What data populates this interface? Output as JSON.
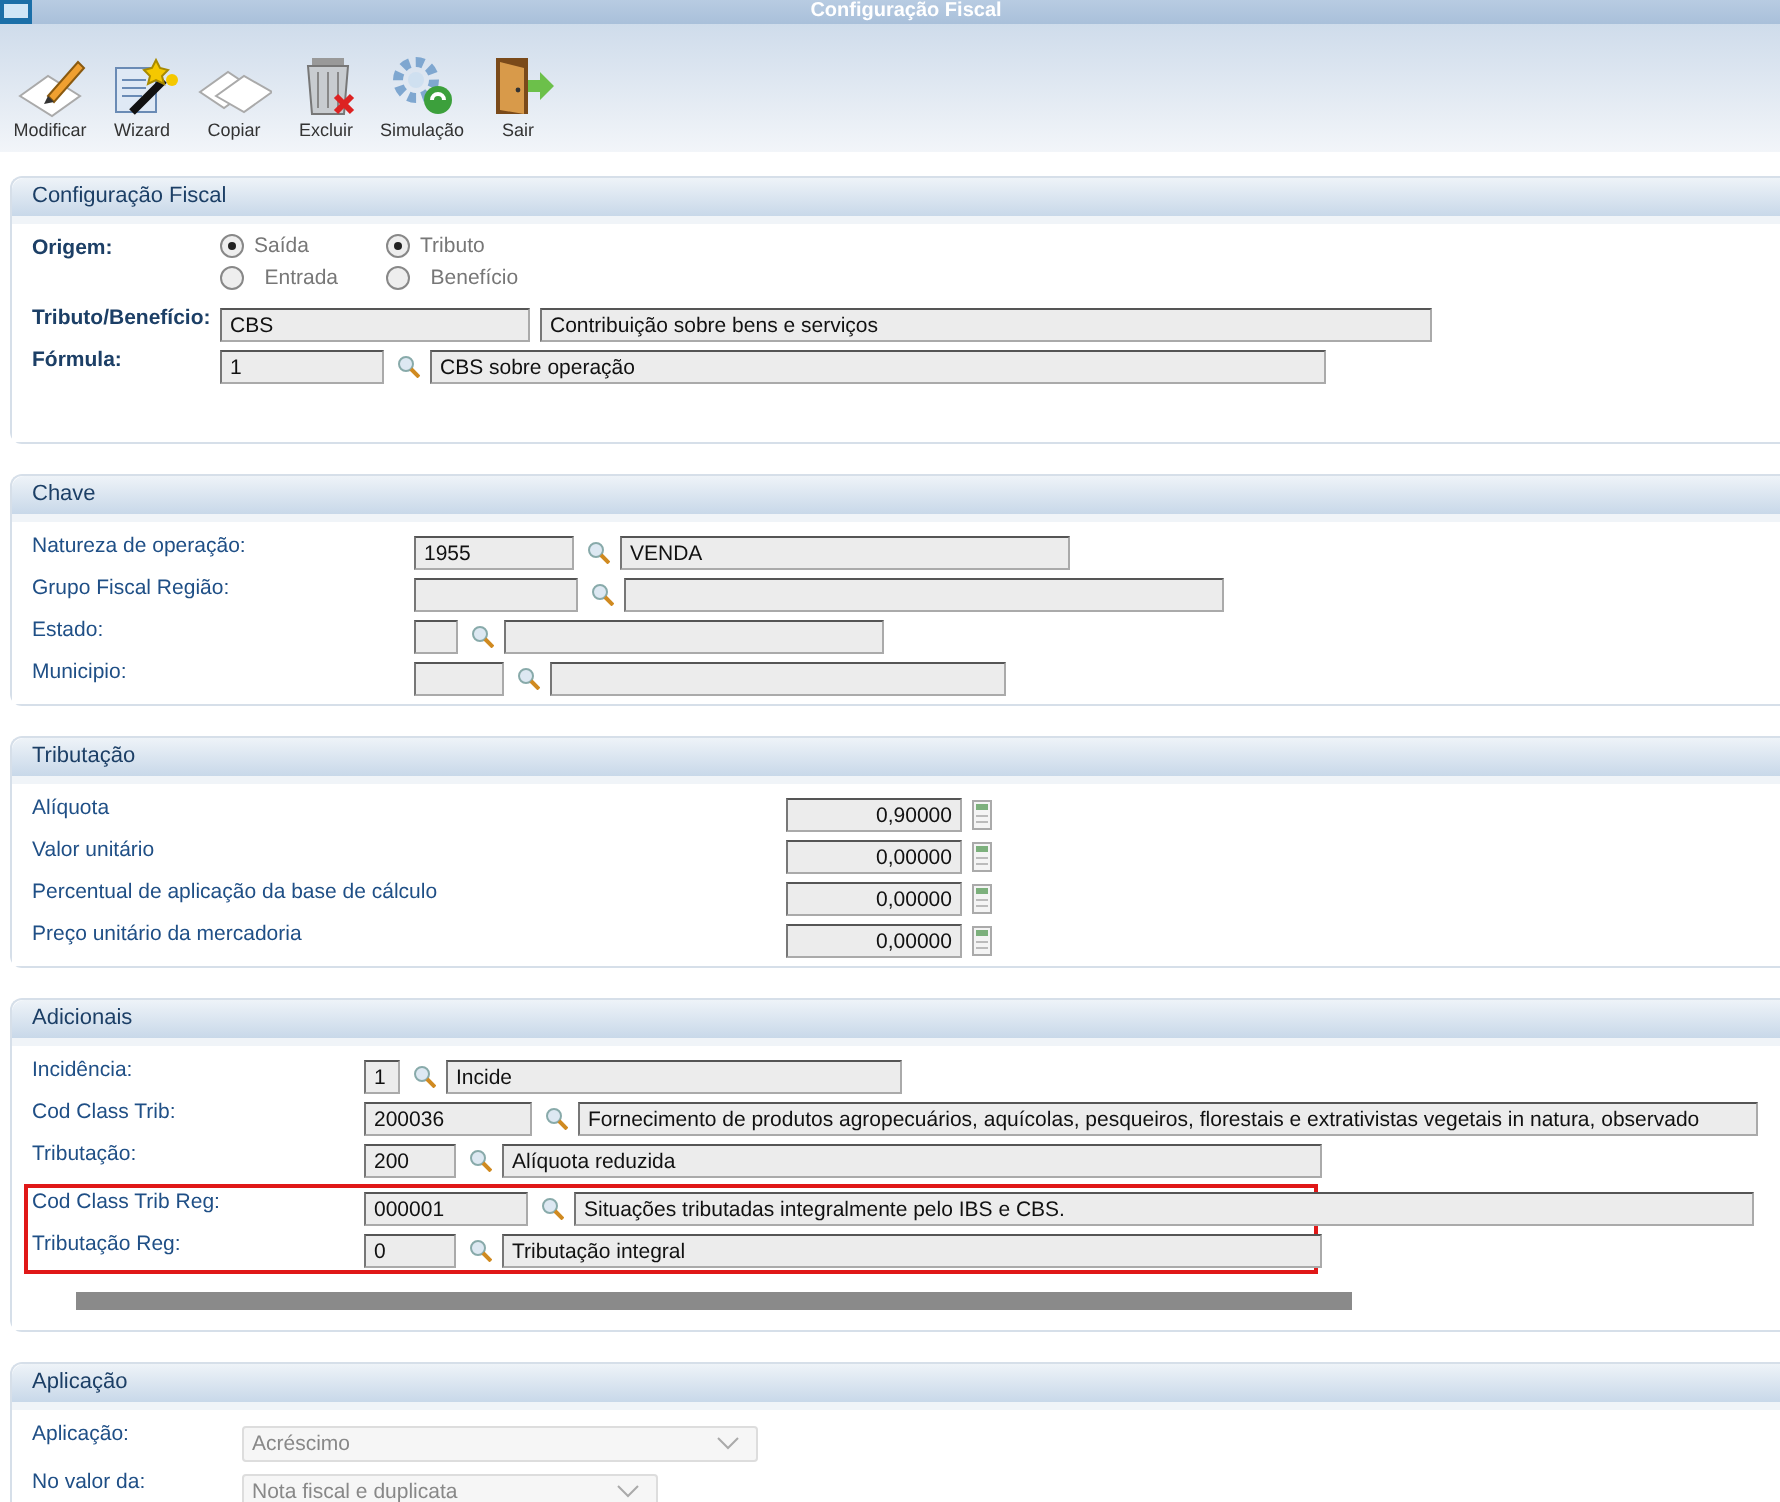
{
  "window": {
    "title": "Configuração Fiscal"
  },
  "toolbar": [
    {
      "label": "Modificar",
      "kind": "pencil"
    },
    {
      "label": "Wizard",
      "kind": "wand"
    },
    {
      "label": "Copiar",
      "kind": "copy"
    },
    {
      "label": "Excluir",
      "kind": "trash"
    },
    {
      "label": "Simulação",
      "kind": "gear"
    },
    {
      "label": "Sair",
      "kind": "door"
    }
  ],
  "sections": [
    {
      "title": "Configuração Fiscal",
      "kind": "config",
      "origem": {
        "label": "Origem:",
        "groups": [
          {
            "options": [
              {
                "label": "Saída",
                "selected": true
              },
              {
                "label": "Entrada",
                "selected": false
              }
            ]
          },
          {
            "options": [
              {
                "label": "Tributo",
                "selected": true
              },
              {
                "label": "Benefício",
                "selected": false
              }
            ]
          }
        ]
      },
      "rows": [
        {
          "label": "Tributo/Benefício:",
          "code": "CBS",
          "description": "Contribuição sobre bens e serviços",
          "lookup": false
        },
        {
          "label": "Fórmula:",
          "code": "1",
          "description": "CBS sobre operação",
          "lookup": true
        }
      ]
    },
    {
      "title": "Chave",
      "kind": "lookups",
      "rows": [
        {
          "label": "Natureza de operação:",
          "code": "1955",
          "description": "VENDA",
          "lookup": true
        },
        {
          "label": "Grupo Fiscal Região:",
          "lookup": true
        },
        {
          "label": "Estado:",
          "lookup": true
        },
        {
          "label": "Municipio:",
          "lookup": true
        }
      ]
    },
    {
      "title": "Tributação",
      "kind": "numbers",
      "rows": [
        {
          "label": "Alíquota",
          "value": "0,90000"
        },
        {
          "label": "Valor unitário",
          "value": "0,00000"
        },
        {
          "label": "Percentual de aplicação da base de cálculo",
          "value": "0,00000"
        },
        {
          "label": "Preço unitário da mercadoria",
          "value": "0,00000"
        }
      ]
    },
    {
      "title": "Adicionais",
      "kind": "lookups",
      "rows": [
        {
          "label": "Incidência:",
          "code": "1",
          "description": "Incide",
          "lookup": true,
          "highlighted": false
        },
        {
          "label": "Cod Class Trib:",
          "code": "200036",
          "description": "Fornecimento de produtos agropecuários, aquícolas, pesqueiros, florestais e extrativistas vegetais in natura, observado",
          "lookup": true,
          "highlighted": false
        },
        {
          "label": "Tributação:",
          "code": "200",
          "description": "Alíquota reduzida",
          "lookup": true,
          "highlighted": false
        },
        {
          "label": "Cod Class Trib Reg:",
          "code": "000001",
          "description": "Situações tributadas integralmente pelo IBS e CBS.",
          "lookup": true,
          "highlighted": true
        },
        {
          "label": "Tributação Reg:",
          "code": "0",
          "description": "Tributação integral",
          "lookup": true,
          "highlighted": true
        }
      ]
    },
    {
      "title": "Aplicação",
      "kind": "selects",
      "rows": [
        {
          "label": "Aplicação:",
          "value": "Acréscimo"
        },
        {
          "label": "No valor da:",
          "value": "Nota fiscal e duplicata"
        }
      ]
    }
  ]
}
